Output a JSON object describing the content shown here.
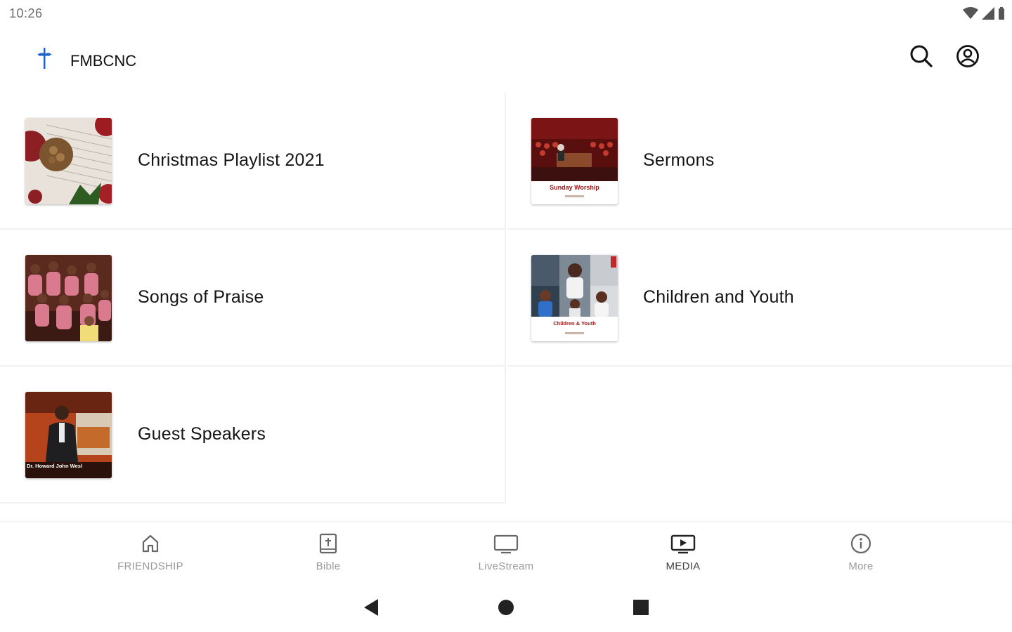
{
  "status_bar": {
    "time": "10:26",
    "icons": [
      "wifi-icon",
      "cellular-signal-icon",
      "battery-icon"
    ]
  },
  "app_bar": {
    "title": "FMBCNC",
    "logo_icon": "cross-logo-icon",
    "actions": [
      "search-icon",
      "account-icon"
    ]
  },
  "media_categories": [
    {
      "label": "Christmas Playlist 2021",
      "thumbnail": "christmas-ornaments-sheet-music"
    },
    {
      "label": "Sermons",
      "thumbnail": "sunday-worship-congregation",
      "thumbnail_caption": "Sunday Worship"
    },
    {
      "label": "Songs of Praise",
      "thumbnail": "choir-in-pink"
    },
    {
      "label": "Children and Youth",
      "thumbnail": "youth-group-collage",
      "thumbnail_caption": "Children & Youth"
    },
    {
      "label": "Guest Speakers",
      "thumbnail": "speaker-at-podium",
      "thumbnail_caption": "Dr. Howard John Wesl"
    }
  ],
  "bottom_nav": {
    "active": "MEDIA",
    "items": [
      {
        "label": "FRIENDSHIP",
        "icon": "home-icon"
      },
      {
        "label": "Bible",
        "icon": "bible-icon"
      },
      {
        "label": "LiveStream",
        "icon": "monitor-icon"
      },
      {
        "label": "MEDIA",
        "icon": "media-play-icon"
      },
      {
        "label": "More",
        "icon": "info-icon"
      }
    ]
  },
  "system_nav": [
    "back-icon",
    "home-circle-icon",
    "recents-square-icon"
  ],
  "colors": {
    "background": "#ffffff",
    "text_primary": "#151515",
    "nav_inactive": "#9a9a9a",
    "nav_active": "#444444",
    "logo_blue": "#1e63c9"
  }
}
